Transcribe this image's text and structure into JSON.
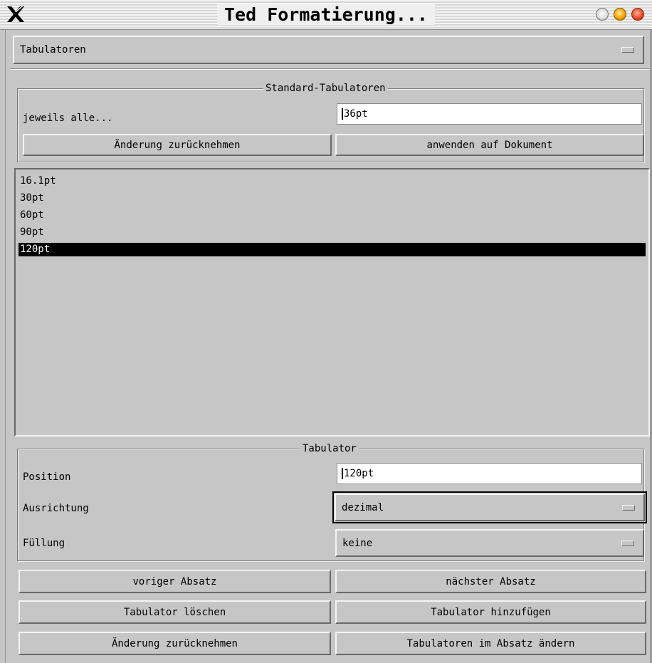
{
  "window": {
    "title": "Ted Formatierung..."
  },
  "page_selector": {
    "value": "Tabulatoren"
  },
  "standard_tabs": {
    "legend": "Standard-Tabulatoren",
    "every_label": "jeweils alle...",
    "every_value": "36pt",
    "revert_label": "Änderung zurücknehmen",
    "apply_label": "anwenden auf Dokument"
  },
  "tab_list": {
    "items": [
      "16.1pt",
      "30pt",
      "60pt",
      "90pt",
      "120pt"
    ],
    "selected_index": 4
  },
  "tab": {
    "legend": "Tabulator",
    "position_label": "Position",
    "position_value": "120pt",
    "alignment_label": "Ausrichtung",
    "alignment_value": "dezimal",
    "leader_label": "Füllung",
    "leader_value": "keine"
  },
  "buttons": {
    "prev_paragraph": "voriger Absatz",
    "next_paragraph": "nächster Absatz",
    "delete_tab": "Tabulator löschen",
    "add_tab": "Tabulator hinzufügen",
    "revert": "Änderung zurücknehmen",
    "change_tabs": "Tabulatoren im Absatz ändern"
  },
  "icons": {
    "app_icon": "x-logo-icon",
    "minimize": "minimize-icon",
    "maximize": "maximize-icon",
    "close": "close-icon"
  }
}
